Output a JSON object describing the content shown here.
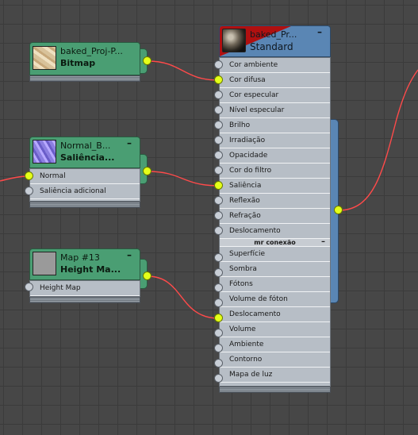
{
  "nodes": {
    "bitmap": {
      "title": "baked_Proj-P...",
      "subtitle": "Bitmap"
    },
    "normal": {
      "title": "Normal_B...",
      "subtitle": "Saliência...",
      "inputs": [
        {
          "label": "Normal",
          "connected": true
        },
        {
          "label": "Saliência adicional",
          "connected": false
        }
      ]
    },
    "map13": {
      "title": "Map #13",
      "subtitle": "Height Ma...",
      "inputs": [
        {
          "label": "Height Map",
          "connected": false
        }
      ]
    },
    "material": {
      "title": "baked_Pr...",
      "subtitle": "Standard",
      "inputs": [
        {
          "label": "Cor ambiente",
          "connected": false
        },
        {
          "label": "Cor difusa",
          "connected": true
        },
        {
          "label": "Cor especular",
          "connected": false
        },
        {
          "label": "Nível especular",
          "connected": false
        },
        {
          "label": "Brilho",
          "connected": false
        },
        {
          "label": "Irradiação",
          "connected": false
        },
        {
          "label": "Opacidade",
          "connected": false
        },
        {
          "label": "Cor do filtro",
          "connected": false
        },
        {
          "label": "Saliência",
          "connected": true
        },
        {
          "label": "Reflexão",
          "connected": false
        },
        {
          "label": "Refração",
          "connected": false
        },
        {
          "label": "Deslocamento",
          "connected": false
        }
      ],
      "section": "mr conexão",
      "mr_inputs": [
        {
          "label": "Superfície",
          "connected": false
        },
        {
          "label": "Sombra",
          "connected": false
        },
        {
          "label": "Fótons",
          "connected": false
        },
        {
          "label": "Volume de fóton",
          "connected": false
        },
        {
          "label": "Deslocamento",
          "connected": true
        },
        {
          "label": "Volume",
          "connected": false
        },
        {
          "label": "Ambiente",
          "connected": false
        },
        {
          "label": "Contorno",
          "connected": false
        },
        {
          "label": "Mapa de luz",
          "connected": false
        }
      ]
    }
  },
  "icons": {
    "collapse": "minus-icon"
  },
  "colors": {
    "wire": "#ff4a4a",
    "socket_active": "#e4ff1a",
    "map_node_header": "#4a9e73",
    "material_header": "#5a86b4",
    "material_header_accent": "#b01010"
  }
}
